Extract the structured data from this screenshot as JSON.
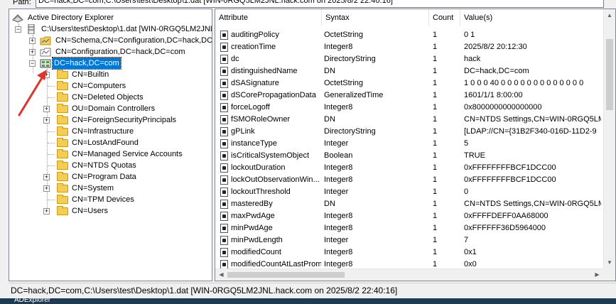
{
  "path_bar": {
    "label": "Path:",
    "value": "DC=hack,DC=com,C:\\Users\\test\\Desktop\\1.dat [WIN-0RGQ5LM2JNL.hack.com on 2025/8/2 22:40:16]"
  },
  "tree": {
    "root_label": "Active Directory Explorer",
    "file_label": "C:\\Users\\test\\Desktop\\1.dat [WIN-0RGQ5LM2JNL",
    "top_nodes": [
      {
        "label": "CN=Schema,CN=Configuration,DC=hack,DC",
        "icon": "schema-icon"
      },
      {
        "label": "CN=Configuration,DC=hack,DC=com",
        "icon": "configuration-icon"
      },
      {
        "label": "DC=hack,DC=com",
        "icon": "domain-icon",
        "selected": true
      }
    ],
    "children": [
      {
        "label": "CN=Builtin",
        "expander": true
      },
      {
        "label": "CN=Computers",
        "expander": false
      },
      {
        "label": "CN=Deleted Objects",
        "expander": false
      },
      {
        "label": "OU=Domain Controllers",
        "expander": true
      },
      {
        "label": "CN=ForeignSecurityPrincipals",
        "expander": true
      },
      {
        "label": "CN=Infrastructure",
        "expander": false
      },
      {
        "label": "CN=LostAndFound",
        "expander": false
      },
      {
        "label": "CN=Managed Service Accounts",
        "expander": false
      },
      {
        "label": "CN=NTDS Quotas",
        "expander": false
      },
      {
        "label": "CN=Program Data",
        "expander": true
      },
      {
        "label": "CN=System",
        "expander": true
      },
      {
        "label": "CN=TPM Devices",
        "expander": false
      },
      {
        "label": "CN=Users",
        "expander": true
      }
    ]
  },
  "table": {
    "columns": [
      "Attribute",
      "Syntax",
      "Count",
      "Value(s)"
    ],
    "rows": [
      [
        "auditingPolicy",
        "OctetString",
        "1",
        "0 1"
      ],
      [
        "creationTime",
        "Integer8",
        "1",
        "2025/8/2 20:12:30"
      ],
      [
        "dc",
        "DirectoryString",
        "1",
        "hack"
      ],
      [
        "distinguishedName",
        "DN",
        "1",
        "DC=hack,DC=com"
      ],
      [
        "dSASignature",
        "OctetString",
        "1",
        "1 0 0 0 40 0 0 0 0 0 0 0 0 0 0 0 0 0"
      ],
      [
        "dSCorePropagationData",
        "GeneralizedTime",
        "1",
        "1601/1/1 8:00:00"
      ],
      [
        "forceLogoff",
        "Integer8",
        "1",
        "0x8000000000000000"
      ],
      [
        "fSMORoleOwner",
        "DN",
        "1",
        "CN=NTDS Settings,CN=WIN-0RGQ5LM"
      ],
      [
        "gPLink",
        "DirectoryString",
        "1",
        "[LDAP://CN={31B2F340-016D-11D2-9"
      ],
      [
        "instanceType",
        "Integer",
        "1",
        "5"
      ],
      [
        "isCriticalSystemObject",
        "Boolean",
        "1",
        "TRUE"
      ],
      [
        "lockoutDuration",
        "Integer8",
        "1",
        "0xFFFFFFFFBCF1DCC00"
      ],
      [
        "lockOutObservationWin...",
        "Integer8",
        "1",
        "0xFFFFFFFFBCF1DCC00"
      ],
      [
        "lockoutThreshold",
        "Integer",
        "1",
        "0"
      ],
      [
        "masteredBy",
        "DN",
        "1",
        "CN=NTDS Settings,CN=WIN-0RGQ5LM"
      ],
      [
        "maxPwdAge",
        "Integer8",
        "1",
        "0xFFFFDEFF0AA68000"
      ],
      [
        "minPwdAge",
        "Integer8",
        "1",
        "0xFFFFFF36D5964000"
      ],
      [
        "minPwdLength",
        "Integer",
        "1",
        "7"
      ],
      [
        "modifiedCount",
        "Integer8",
        "1",
        "0x1"
      ],
      [
        "modifiedCountAtLastProm",
        "Integer8",
        "1",
        "0x0"
      ]
    ]
  },
  "status_bar": {
    "text": "DC=hack,DC=com,C:\\Users\\test\\Desktop\\1.dat [WIN-0RGQ5LM2JNL.hack.com on 2025/8/2 22:40:16]"
  },
  "taskbar": {
    "label": "ADExplorer"
  },
  "colors": {
    "selection": "#0078d7",
    "annotation_arrow": "#e0332b",
    "folder": "#f4cd56"
  }
}
